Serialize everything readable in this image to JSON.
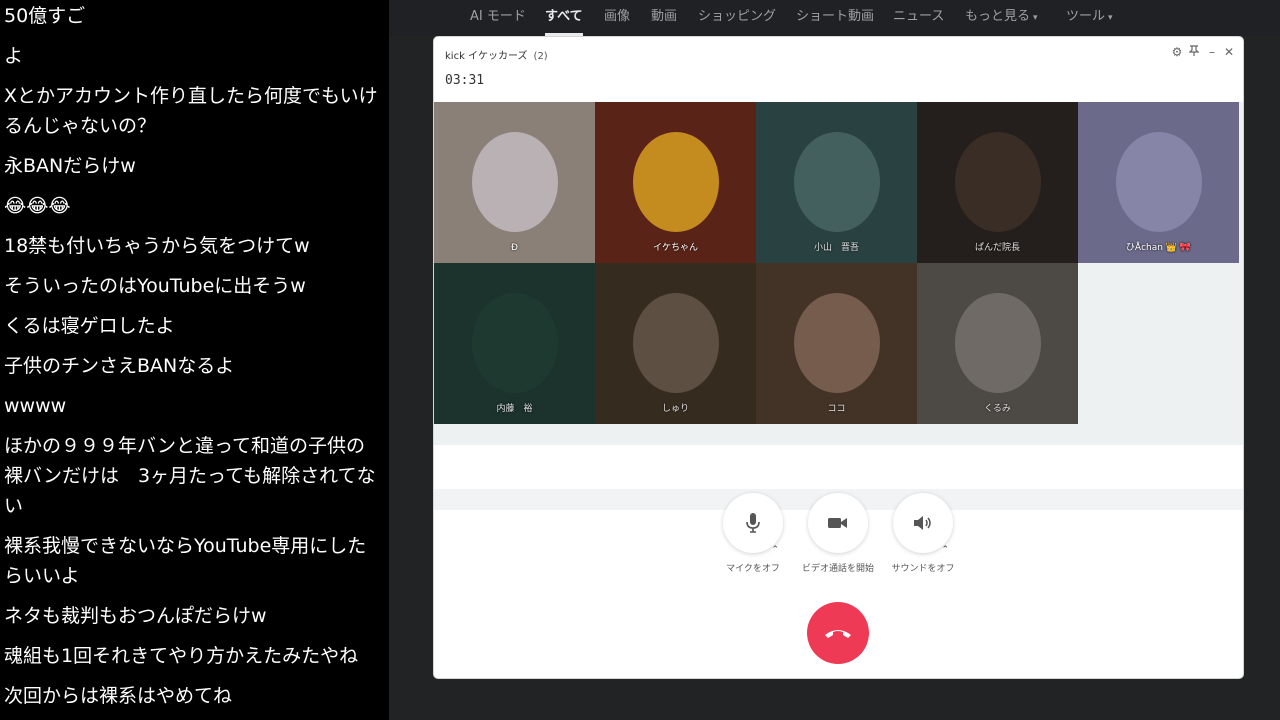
{
  "chat": {
    "messages": [
      "50億すご",
      "よ",
      "Xとかアカウント作り直したら何度でもいけるんじゃないの？",
      "永BANだらけw",
      "😂😂😂",
      "18禁も付いちゃうから気をつけてw",
      "そういったのはYouTubeに出そうw",
      "くるは寝ゲロしたよ",
      "子供のチンさえBANなるよ",
      "wwww",
      "ほかの９９９年バンと違って和道の子供の裸バンだけは　3ヶ月たっても解除されてない",
      "裸系我慢できないならYouTube専用にしたらいいよ",
      "ネタも裁判もおつんぽだらけw",
      "魂組も1回それきてやり方かえたみたやね",
      "次回からは裸系はやめてね"
    ]
  },
  "nav": {
    "tabs": [
      {
        "label": "AI モード",
        "active": false
      },
      {
        "label": "すべて",
        "active": true
      },
      {
        "label": "画像",
        "active": false
      },
      {
        "label": "動画",
        "active": false
      },
      {
        "label": "ショッピング",
        "active": false
      },
      {
        "label": "ショート動画",
        "active": false
      },
      {
        "label": "ニュース",
        "active": false
      },
      {
        "label": "もっと見る",
        "active": false
      },
      {
        "label": "ツール",
        "active": false
      }
    ]
  },
  "call": {
    "title": "kick イケッカーズ",
    "member_count": "(2)",
    "timer": "03:31",
    "participants": [
      {
        "name": "Đ",
        "bg": "#8a8078",
        "accent": "#c9c2c8"
      },
      {
        "name": "イケちゃん",
        "bg": "#5a2318",
        "accent": "#e8b020"
      },
      {
        "name": "小山　晋吾",
        "bg": "#2f4b4a",
        "accent": "#5a7a78"
      },
      {
        "name": "ぱんだ院長",
        "bg": "#2a2420",
        "accent": "#4a3a30"
      },
      {
        "name": "ひÅchan 👑 🎀",
        "bg": "#6b6a8a",
        "accent": "#8f8eb0"
      },
      {
        "name": "内藤　裕",
        "bg": "#1f3b33",
        "accent": "#254539"
      },
      {
        "name": "しゅり",
        "bg": "#3e3224",
        "accent": "#7a6a58"
      },
      {
        "name": "ココ",
        "bg": "#4d3a2c",
        "accent": "#9a7a66"
      },
      {
        "name": "くるみ",
        "bg": "#58554f",
        "accent": "#8c8680"
      }
    ],
    "controls": {
      "mic_label": "マイクをオフ",
      "video_label": "ビデオ通話を開始",
      "sound_label": "サウンドをオフ"
    },
    "colors": {
      "hangup": "#ef3a55"
    }
  }
}
